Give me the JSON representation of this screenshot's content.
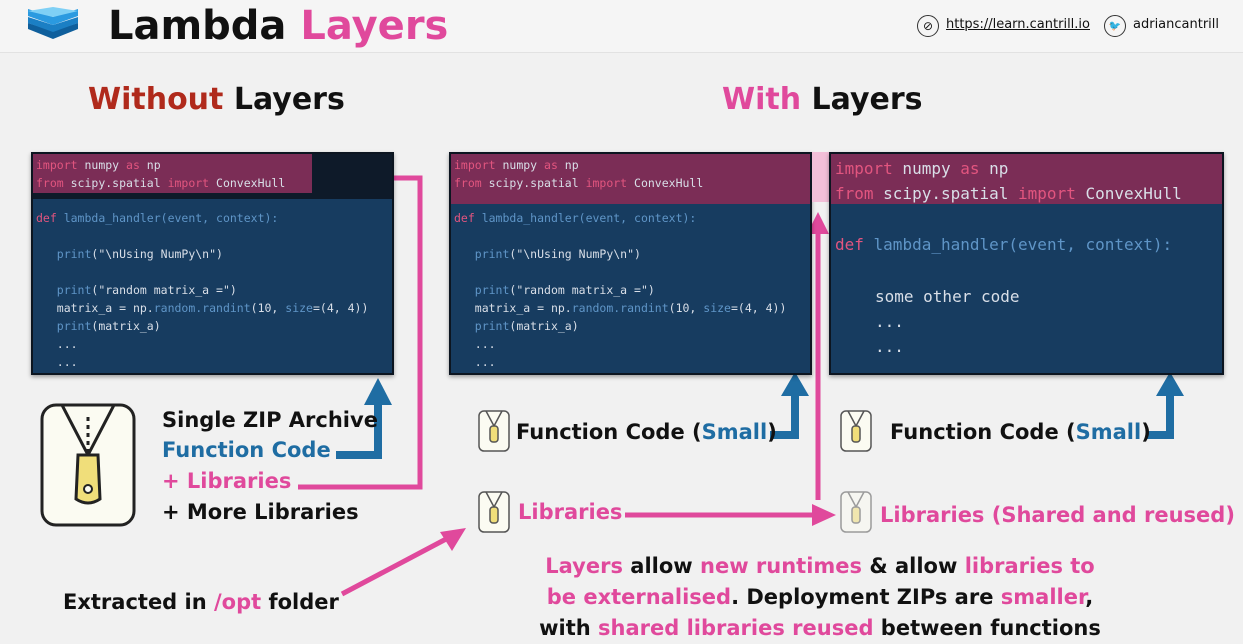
{
  "header": {
    "title_part1": "Lambda",
    "title_part2": "Layers",
    "url": "https://learn.cantrill.io",
    "twitter": "adriancantrill",
    "compass_icon_glyph": "⊘",
    "bird_icon_glyph": "🐦"
  },
  "without": {
    "title_part1": "Without",
    "title_part2": "Layers",
    "zip_line1": "Single ZIP Archive",
    "zip_line2": "Function Code",
    "zip_line3": "+ Libraries",
    "zip_line4": "+ More Libraries",
    "extracted_prefix": "Extracted in ",
    "extracted_path": "/opt",
    "extracted_suffix": " folder"
  },
  "with": {
    "title_part1": "With",
    "title_part2": "Layers",
    "function_code_prefix": "Function Code (",
    "function_code_small": "Small",
    "function_code_suffix": ")",
    "libraries": "Libraries",
    "libraries_shared": "Libraries (Shared and reused)"
  },
  "code_small": {
    "imp1_kw1": "import",
    "imp1_rest": " numpy ",
    "imp1_kw2": "as",
    "imp1_end": " np",
    "imp2_kw1": "from",
    "imp2_mid": " scipy.spatial ",
    "imp2_kw2": "import",
    "imp2_end": " ConvexHull",
    "def_kw": "def",
    "def_name": " lambda_handler",
    "def_args": "(event, context):",
    "print1": "print",
    "print1_arg": "(\"\\nUsing NumPy\\n\")",
    "print2": "print",
    "print2_arg": "(\"random matrix_a =\")",
    "matrix_pre": "matrix_a = np.",
    "matrix_fn": "random.randint",
    "matrix_args": "(10, ",
    "matrix_size": "size",
    "matrix_end": "=(4, 4))",
    "print3": "print",
    "print3_arg": "(matrix_a)",
    "dots1": "...",
    "dots2": "..."
  },
  "code_large": {
    "imp1_kw1": "import",
    "imp1_rest": " numpy ",
    "imp1_kw2": "as",
    "imp1_end": " np",
    "imp2_kw1": "from",
    "imp2_mid": " scipy.spatial ",
    "imp2_kw2": "import",
    "imp2_end": " ConvexHull",
    "def_kw": "def",
    "def_name": " lambda_handler",
    "def_args": "(event, context):",
    "other": "some other code",
    "dots1": "...",
    "dots2": "..."
  },
  "summary": {
    "l1_a": "Layers",
    "l1_b": " allow ",
    "l1_c": "new runtimes",
    "l1_d": " & allow ",
    "l1_e": "libraries to",
    "l2_a": "be externalised",
    "l2_b": ". Deployment ZIPs are ",
    "l2_c": "smaller",
    "l2_d": ",",
    "l3_a": "with ",
    "l3_b": "shared libraries reused",
    "l3_c": " between functions"
  },
  "colors": {
    "pink": "#e0499c",
    "red": "#b02a1c",
    "blue": "#1f6da3",
    "code_bg": "#173c60",
    "import_bg": "#7b2d56"
  }
}
